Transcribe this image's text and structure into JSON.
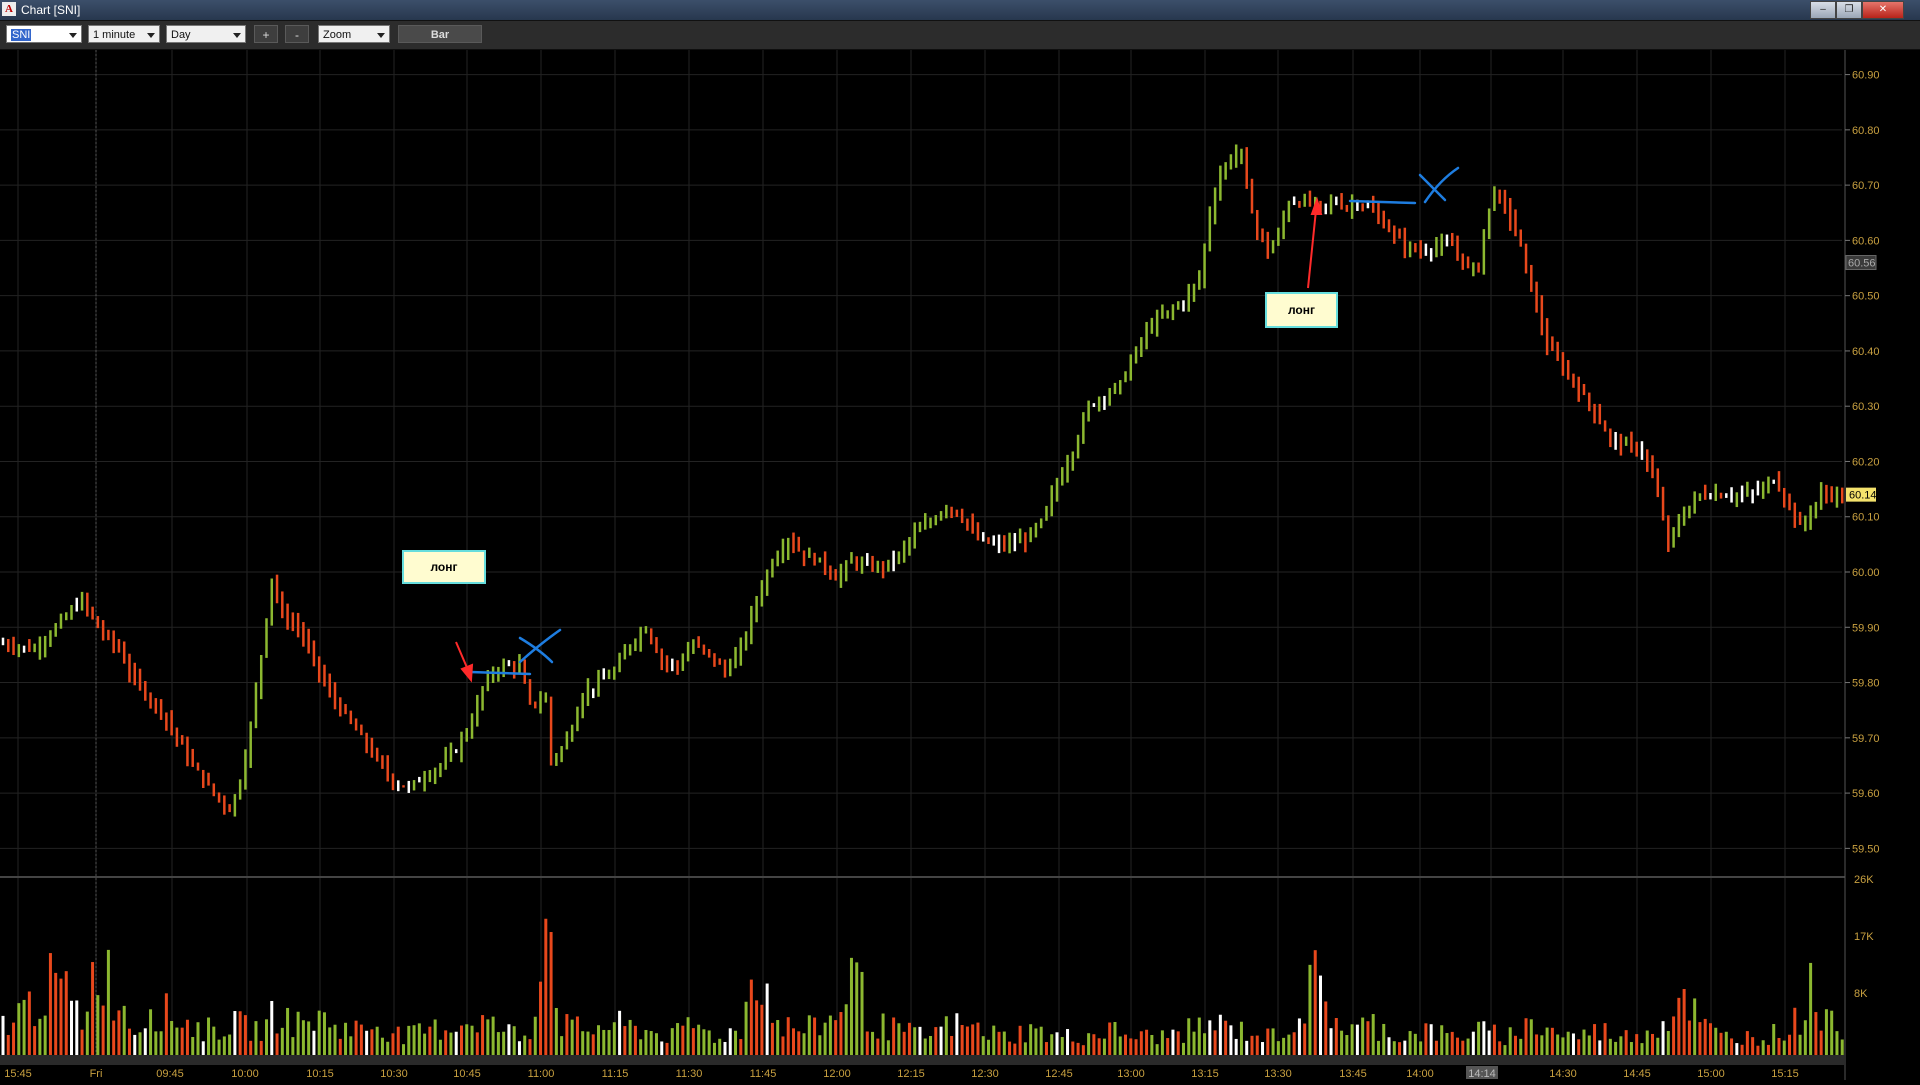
{
  "window": {
    "title": "Chart [SNI]",
    "app_icon": "A",
    "buttons": [
      "minimize-icon",
      "restore-icon",
      "close-icon"
    ]
  },
  "toolbar": {
    "symbol": "SNI",
    "interval": "1 minute",
    "range": "Day",
    "zoom_in": "+",
    "zoom_out": "-",
    "zoom": "Zoom",
    "style_button": "Bar"
  },
  "colors": {
    "up": "#8cb830",
    "down": "#e8481c",
    "neutral": "#ffffff",
    "axis_text": "#c8a040",
    "grid": "#232323",
    "drawing_line": "#1e7de0",
    "arrow": "#ff2a2a"
  },
  "annotations": {
    "callout_1": "лонг",
    "callout_2": "лонг"
  },
  "chart_data": {
    "type": "bar",
    "symbol": "SNI",
    "interval": "1 minute",
    "price_axis": {
      "ticks": [
        "60.90",
        "60.80",
        "60.70",
        "60.60",
        "60.50",
        "60.40",
        "60.30",
        "60.20",
        "60.10",
        "60.00",
        "59.90",
        "59.80",
        "59.70",
        "59.60",
        "59.50"
      ],
      "ylim": [
        59.45,
        60.93
      ],
      "last_price_label": "60.14",
      "crosshair_price_label": "60.56"
    },
    "volume_axis": {
      "ticks": [
        "26K",
        "17K",
        "8K"
      ]
    },
    "time_axis": {
      "ticks": [
        "15:45",
        "Fri",
        "09:45",
        "10:00",
        "10:15",
        "10:30",
        "10:45",
        "11:00",
        "11:15",
        "11:30",
        "11:45",
        "12:00",
        "12:15",
        "12:30",
        "12:45",
        "13:00",
        "13:15",
        "13:30",
        "13:45",
        "14:00",
        "14:30",
        "14:45",
        "15:00",
        "15:15"
      ],
      "cursor_label": "14:14"
    },
    "price_path": [
      [
        0,
        59.87
      ],
      [
        6,
        59.86
      ],
      [
        12,
        59.92
      ],
      [
        15,
        59.95
      ],
      [
        18,
        59.9
      ],
      [
        22,
        59.86
      ],
      [
        24,
        59.82
      ],
      [
        27,
        59.78
      ],
      [
        30,
        59.75
      ],
      [
        33,
        59.7
      ],
      [
        36,
        59.65
      ],
      [
        40,
        59.6
      ],
      [
        43,
        59.57
      ],
      [
        45,
        59.62
      ],
      [
        47,
        59.72
      ],
      [
        49,
        59.85
      ],
      [
        51,
        59.99
      ],
      [
        53,
        59.92
      ],
      [
        56,
        59.9
      ],
      [
        59,
        59.84
      ],
      [
        62,
        59.78
      ],
      [
        65,
        59.74
      ],
      [
        68,
        59.7
      ],
      [
        71,
        59.66
      ],
      [
        74,
        59.62
      ],
      [
        77,
        59.61
      ],
      [
        80,
        59.63
      ],
      [
        83,
        59.65
      ],
      [
        86,
        59.68
      ],
      [
        89,
        59.73
      ],
      [
        91,
        59.79
      ],
      [
        93,
        59.82
      ],
      [
        95,
        59.83
      ],
      [
        98,
        59.83
      ],
      [
        100,
        59.76
      ],
      [
        103,
        59.77
      ],
      [
        104,
        59.66
      ],
      [
        106,
        59.68
      ],
      [
        108,
        59.72
      ],
      [
        110,
        59.78
      ],
      [
        113,
        59.8
      ],
      [
        116,
        59.82
      ],
      [
        119,
        59.87
      ],
      [
        122,
        59.9
      ],
      [
        125,
        59.84
      ],
      [
        128,
        59.83
      ],
      [
        131,
        59.87
      ],
      [
        134,
        59.85
      ],
      [
        137,
        59.82
      ],
      [
        140,
        59.86
      ],
      [
        143,
        59.95
      ],
      [
        146,
        60.02
      ],
      [
        149,
        60.06
      ],
      [
        152,
        60.03
      ],
      [
        155,
        60.02
      ],
      [
        158,
        59.99
      ],
      [
        161,
        60.02
      ],
      [
        164,
        60.01
      ],
      [
        167,
        60.01
      ],
      [
        170,
        60.03
      ],
      [
        173,
        60.07
      ],
      [
        176,
        60.09
      ],
      [
        179,
        60.12
      ],
      [
        182,
        60.1
      ],
      [
        185,
        60.06
      ],
      [
        188,
        60.05
      ],
      [
        191,
        60.05
      ],
      [
        194,
        60.06
      ],
      [
        197,
        60.09
      ],
      [
        200,
        60.16
      ],
      [
        203,
        60.22
      ],
      [
        206,
        60.3
      ],
      [
        209,
        60.32
      ],
      [
        212,
        60.34
      ],
      [
        215,
        60.4
      ],
      [
        218,
        60.45
      ],
      [
        221,
        60.47
      ],
      [
        224,
        60.49
      ],
      [
        227,
        60.53
      ],
      [
        229,
        60.65
      ],
      [
        231,
        60.72
      ],
      [
        233,
        60.75
      ],
      [
        235,
        60.76
      ],
      [
        236,
        60.69
      ],
      [
        238,
        60.62
      ],
      [
        240,
        60.58
      ],
      [
        242,
        60.61
      ],
      [
        244,
        60.67
      ],
      [
        247,
        60.67
      ],
      [
        250,
        60.66
      ],
      [
        253,
        60.67
      ],
      [
        255,
        60.66
      ],
      [
        257,
        60.67
      ],
      [
        259,
        60.66
      ],
      [
        261,
        60.64
      ],
      [
        263,
        60.62
      ],
      [
        266,
        60.59
      ],
      [
        269,
        60.58
      ],
      [
        272,
        60.59
      ],
      [
        275,
        60.59
      ],
      [
        278,
        60.55
      ],
      [
        280,
        60.55
      ],
      [
        281,
        60.62
      ],
      [
        283,
        60.69
      ],
      [
        285,
        60.66
      ],
      [
        287,
        60.62
      ],
      [
        289,
        60.55
      ],
      [
        291,
        60.48
      ],
      [
        293,
        60.41
      ],
      [
        296,
        60.37
      ],
      [
        299,
        60.33
      ],
      [
        302,
        60.29
      ],
      [
        305,
        60.24
      ],
      [
        308,
        60.23
      ],
      [
        311,
        60.22
      ],
      [
        313,
        60.17
      ],
      [
        315,
        60.1
      ],
      [
        316,
        60.05
      ],
      [
        318,
        60.09
      ],
      [
        320,
        60.12
      ],
      [
        322,
        60.14
      ],
      [
        325,
        60.14
      ],
      [
        328,
        60.14
      ],
      [
        331,
        60.14
      ],
      [
        334,
        60.15
      ],
      [
        336,
        60.17
      ],
      [
        339,
        60.12
      ],
      [
        341,
        60.08
      ],
      [
        343,
        60.11
      ],
      [
        345,
        60.14
      ]
    ],
    "volume_path": [
      [
        0,
        5
      ],
      [
        5,
        8
      ],
      [
        10,
        12
      ],
      [
        15,
        6
      ],
      [
        18,
        16
      ],
      [
        22,
        9
      ],
      [
        25,
        4
      ],
      [
        28,
        8
      ],
      [
        33,
        6
      ],
      [
        38,
        4
      ],
      [
        44,
        5
      ],
      [
        49,
        4
      ],
      [
        52,
        7
      ],
      [
        56,
        5
      ],
      [
        60,
        6
      ],
      [
        66,
        4
      ],
      [
        71,
        5
      ],
      [
        76,
        3
      ],
      [
        81,
        4
      ],
      [
        86,
        5
      ],
      [
        90,
        6
      ],
      [
        95,
        4
      ],
      [
        100,
        3
      ],
      [
        103,
        26
      ],
      [
        106,
        5
      ],
      [
        110,
        4
      ],
      [
        116,
        5
      ],
      [
        122,
        4
      ],
      [
        127,
        3
      ],
      [
        131,
        5
      ],
      [
        135,
        3
      ],
      [
        140,
        4
      ],
      [
        143,
        16
      ],
      [
        147,
        5
      ],
      [
        152,
        4
      ],
      [
        158,
        6
      ],
      [
        161,
        14
      ],
      [
        165,
        5
      ],
      [
        170,
        4
      ],
      [
        175,
        3
      ],
      [
        180,
        5
      ],
      [
        186,
        4
      ],
      [
        190,
        3
      ],
      [
        195,
        4
      ],
      [
        200,
        3
      ],
      [
        205,
        3
      ],
      [
        210,
        4
      ],
      [
        215,
        3
      ],
      [
        220,
        3
      ],
      [
        225,
        4
      ],
      [
        230,
        5
      ],
      [
        235,
        4
      ],
      [
        240,
        3
      ],
      [
        245,
        5
      ],
      [
        249,
        12
      ],
      [
        252,
        7
      ],
      [
        255,
        4
      ],
      [
        260,
        5
      ],
      [
        265,
        3
      ],
      [
        270,
        4
      ],
      [
        275,
        3
      ],
      [
        280,
        4
      ],
      [
        285,
        3
      ],
      [
        290,
        5
      ],
      [
        294,
        4
      ],
      [
        298,
        3
      ],
      [
        303,
        4
      ],
      [
        308,
        3
      ],
      [
        312,
        4
      ],
      [
        316,
        6
      ],
      [
        319,
        11
      ],
      [
        322,
        5
      ],
      [
        326,
        3
      ],
      [
        330,
        3
      ],
      [
        334,
        3
      ],
      [
        338,
        4
      ],
      [
        341,
        6
      ],
      [
        343,
        12
      ],
      [
        346,
        5
      ]
    ]
  }
}
